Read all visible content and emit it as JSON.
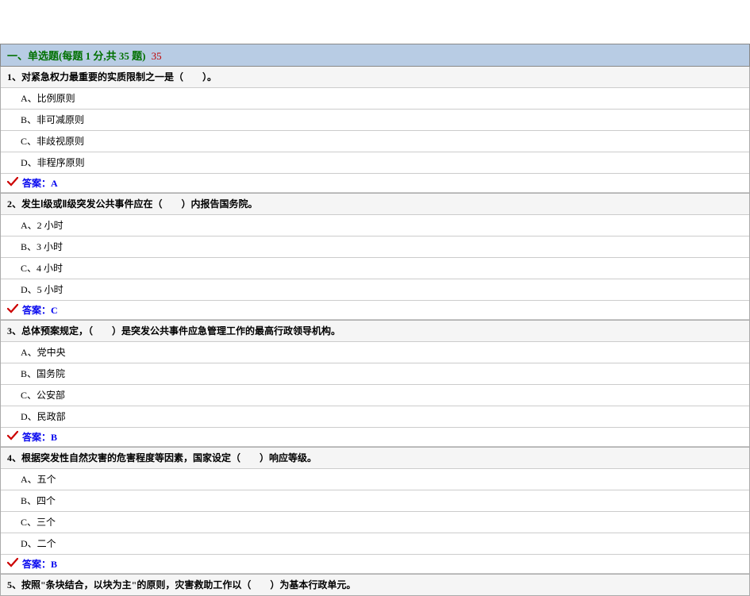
{
  "section": {
    "label": "一、单选题(每题 1 分,共 35 题)",
    "score": "35"
  },
  "questions": [
    {
      "stem": "1、对紧急权力最重要的实质限制之一是（　　）。",
      "options": [
        "A、比例原则",
        "B、非可减原则",
        "C、非歧视原则",
        "D、非程序原则"
      ],
      "answer": "答案：A"
    },
    {
      "stem": "2、发生Ⅰ级或Ⅱ级突发公共事件应在（　　）内报告国务院。",
      "options": [
        "A、2 小时",
        "B、3 小时",
        "C、4 小时",
        "D、5 小时"
      ],
      "answer": "答案：C"
    },
    {
      "stem": "3、总体预案规定，（　　）是突发公共事件应急管理工作的最高行政领导机构。",
      "options": [
        "A、党中央",
        "B、国务院",
        "C、公安部",
        "D、民政部"
      ],
      "answer": "答案：B"
    },
    {
      "stem": "4、根据突发性自然灾害的危害程度等因素，国家设定（　　）响应等级。",
      "options": [
        "A、五个",
        "B、四个",
        "C、三个",
        "D、二个"
      ],
      "answer": "答案：B"
    },
    {
      "stem": "5、按照\"条块结合，以块为主\"的原则，灾害救助工作以（　　）为基本行政单元。",
      "options": [],
      "answer": null
    }
  ]
}
